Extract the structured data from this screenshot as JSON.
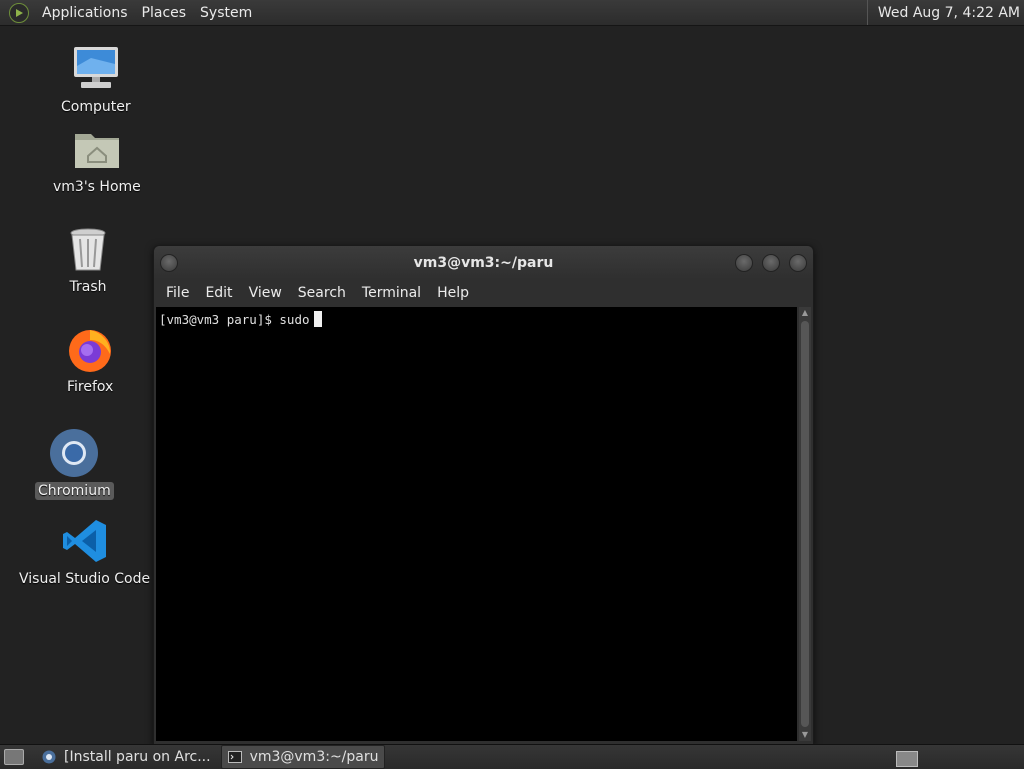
{
  "top_panel": {
    "menus": [
      "Applications",
      "Places",
      "System"
    ],
    "clock": "Wed Aug  7,  4:22 AM"
  },
  "desktop_icons": [
    {
      "label": "Computer",
      "icon": "computer-icon"
    },
    {
      "label": "vm3's Home",
      "icon": "home-folder-icon"
    },
    {
      "label": "Trash",
      "icon": "trash-icon"
    },
    {
      "label": "Firefox",
      "icon": "firefox-icon"
    },
    {
      "label": "Chromium",
      "icon": "chromium-icon"
    },
    {
      "label": "Visual Studio Code",
      "icon": "vscode-icon"
    }
  ],
  "terminal": {
    "title": "vm3@vm3:~/paru",
    "menus": [
      "File",
      "Edit",
      "View",
      "Search",
      "Terminal",
      "Help"
    ],
    "line": "[vm3@vm3 paru]$ sudo"
  },
  "taskbar": {
    "tasks": [
      {
        "label": "[Install paru on Arc...",
        "icon": "chromium-icon"
      },
      {
        "label": "vm3@vm3:~/paru",
        "icon": "terminal-icon"
      }
    ]
  },
  "colors": {
    "desktop": "#222222",
    "panel": "#2c2c2c",
    "terminal_bg": "#000000"
  }
}
